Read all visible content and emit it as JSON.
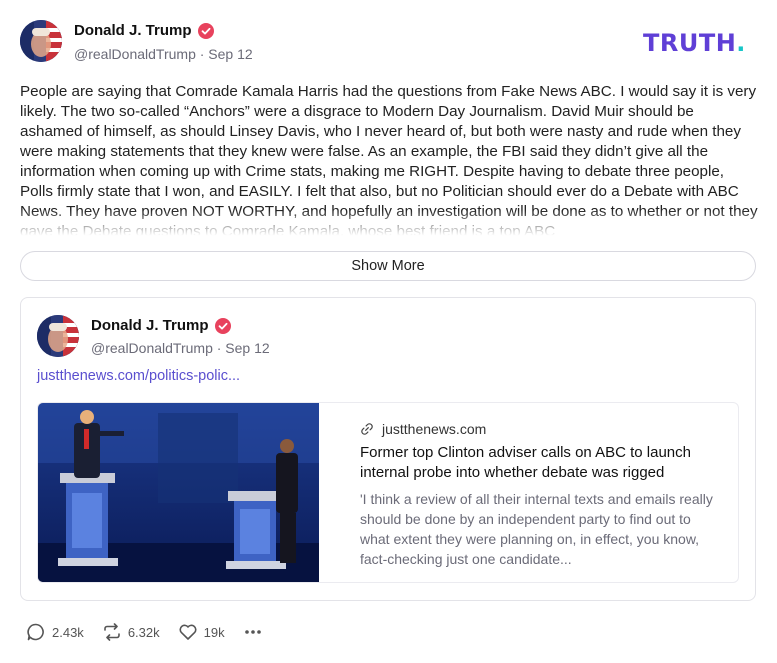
{
  "post": {
    "author": "Donald J. Trump",
    "handle_date": "@realDonaldTrump · Sep 12",
    "text": "People are saying that Comrade Kamala Harris had the questions from Fake News ABC. I would say it is very likely. The two so-called “Anchors” were a disgrace to Modern Day Journalism. David Muir should be ashamed of himself, as should Linsey Davis, who I never heard of, but both were nasty and rude when they were making statements that they knew were false. As an example, the FBI said they didn’t give all the information when coming up with Crime stats, making me RIGHT. Despite having to debate three people, Polls firmly state that I won, and EASILY. I felt that also, but no Politician should ever do a Debate with ABC News. They have proven NOT WORTHY, and hopefully an investigation will be done as to whether or not they gave the Debate questions to Comrade Kamala, whose best friend is a top ABC",
    "show_more_label": "Show More"
  },
  "logo": {
    "text": "TRUTH",
    "dot": "."
  },
  "quote": {
    "author": "Donald J. Trump",
    "handle_date": "@realDonaldTrump · Sep 12",
    "link_text": "justthenews.com/politics-polic...",
    "preview": {
      "domain": "justthenews.com",
      "title": "Former top Clinton adviser calls on ABC to launch internal probe into whether debate was rigged",
      "description": "'I think a review of all their internal texts and emails really should be done by an independent party to find out to what extent they were planning on, in effect, you know, fact-checking just one candidate..."
    }
  },
  "actions": {
    "replies": "2.43k",
    "retruths": "6.32k",
    "likes": "19k"
  },
  "colors": {
    "brand": "#5f3fd6",
    "brand_dot": "#17c6c8",
    "link": "#5a4fcf",
    "verified": "#e8425d"
  },
  "icons": [
    "verified-badge-icon",
    "link-icon",
    "reply-icon",
    "retruth-icon",
    "like-icon",
    "more-icon"
  ]
}
